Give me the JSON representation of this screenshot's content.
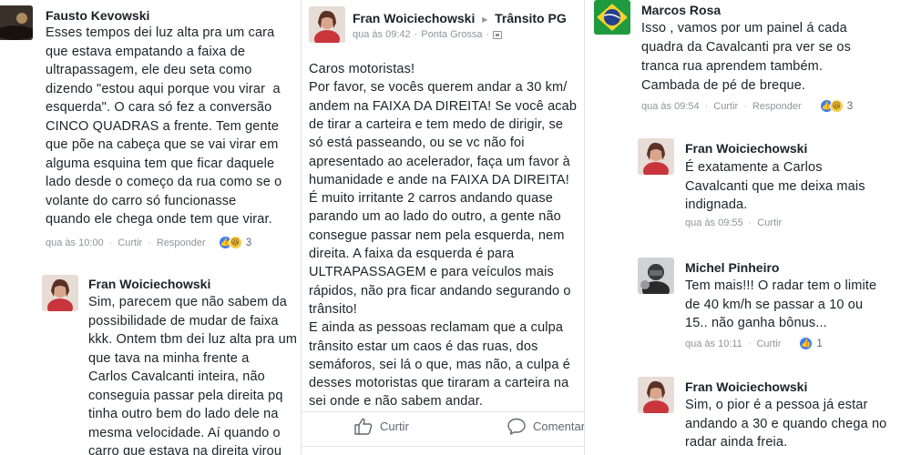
{
  "col1": {
    "comment1": {
      "author": "Fausto Kevowski",
      "lines": [
        "Esses tempos dei luz alta pra um cara",
        "que estava empatando a faixa de",
        "ultrapassagem, ele deu seta como",
        "dizendo \"estou aqui porque vou virar  a",
        "esquerda\". O cara só fez a conversão",
        "CINCO QUADRAS a frente. Tem gente",
        "que põe na cabeça que se vai virar em",
        "alguma esquina tem que ficar daquele",
        "lado desde o começo da rua como se o",
        "volante do carro só funcionasse",
        "quando ele chega onde tem que virar."
      ],
      "time": "qua às 10:00",
      "like": "Curtir",
      "reply": "Responder",
      "reactions": "3"
    },
    "comment2": {
      "author": "Fran Woiciechowski",
      "lines": [
        "Sim, parecem que não sabem da",
        "possibilidade de mudar de faixa",
        "kkk. Ontem tbm dei luz alta pra um",
        "que tava na minha frente a",
        "Carlos Cavalcanti inteira, não",
        "conseguia passar pela direita pq",
        "tinha outro bem do lado dele na",
        "mesma velocidade. Aí quando o",
        "carro que estava na direita virou"
      ]
    }
  },
  "col2": {
    "author": "Fran Woiciechowski",
    "arrow": "▸",
    "group": "Trânsito PG",
    "time": "qua às 09:42",
    "location": "Ponta Grossa",
    "lines": [
      "Caros motoristas!",
      "Por favor, se vocês querem andar a 30 km/",
      "andem na FAIXA DA DIREITA! Se você acab",
      "de tirar a carteira e tem medo de dirigir, se",
      "só está passeando, ou se vc não foi",
      "apresentado ao acelerador, faça um favor à",
      "humanidade e ande na FAIXA DA DIREITA!",
      "É muito irritante 2 carros andando quase",
      "parando um ao lado do outro, a gente não",
      "consegue passar nem pela esquerda, nem",
      "direita. A faixa da esquerda é para",
      "ULTRAPASSAGEM e para veículos mais",
      "rápidos, não pra ficar andando segurando o",
      "trânsito!",
      "E ainda as pessoas reclamam que a culpa",
      "trânsito estar um caos é das ruas, dos",
      "semáforos, sei lá o que, mas não, a culpa é",
      "desses motoristas que tiraram a carteira na",
      "sei onde e não sabem andar."
    ],
    "like_label": "Curtir",
    "comment_label": "Comentar"
  },
  "col3": {
    "comment1": {
      "author": "Marcos Rosa",
      "lines": [
        "Isso , vamos por um painel á cada",
        "quadra da Cavalcanti pra ver se os",
        "tranca rua aprendem também.",
        "Cambada de pé de breque."
      ],
      "time": "qua às 09:54",
      "like": "Curtir",
      "reply": "Responder",
      "reactions": "3"
    },
    "comment2": {
      "author": "Fran Woiciechowski",
      "lines": [
        "É exatamente a Carlos",
        "Cavalcanti que me deixa mais",
        "indignada."
      ],
      "time": "qua às 09:55",
      "like": "Curtir"
    },
    "comment3": {
      "author": "Michel Pinheiro",
      "lines": [
        "Tem mais!!! O radar tem o limite",
        "de 40 km/h se passar a 10 ou",
        "15.. não ganha bônus..."
      ],
      "time": "qua às 10:11",
      "like": "Curtir",
      "reactions": "1"
    },
    "comment4": {
      "author": "Fran Woiciechowski",
      "lines": [
        "Sim, o pior é a pessoa já estar",
        "andando a 30 e quando chega no",
        "radar ainda freia."
      ]
    }
  },
  "colors": {
    "text": "#1d2129",
    "meta": "#90949c",
    "like_blue": "#3b7cf0",
    "haha_yellow": "#f7c948"
  }
}
